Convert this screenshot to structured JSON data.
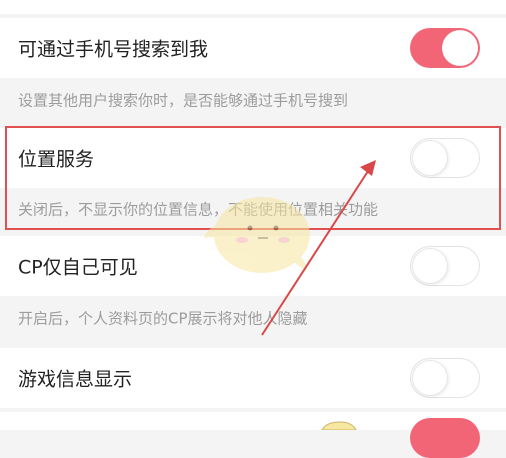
{
  "settings": [
    {
      "label": "可通过手机号搜索到我",
      "enabled": true
    },
    {
      "label": "位置服务",
      "enabled": false
    },
    {
      "label": "CP仅自己可见",
      "enabled": false
    },
    {
      "label": "游戏信息显示",
      "enabled": false
    }
  ],
  "descriptions": {
    "phone_search": "设置其他用户搜索你时，是否能够通过手机号搜到",
    "location": "关闭后，不显示你的位置信息，不能使用位置相关功能",
    "cp_visibility": "开启后，个人资料页的CP展示将对他人隐藏"
  },
  "colors": {
    "toggle_on": "#f26577",
    "highlight_box": "#e05050",
    "arrow": "#d94848",
    "mascot": "#f7e7a0"
  },
  "icons": [
    "arrow-annotation-icon",
    "mascot-watermark-icon"
  ]
}
